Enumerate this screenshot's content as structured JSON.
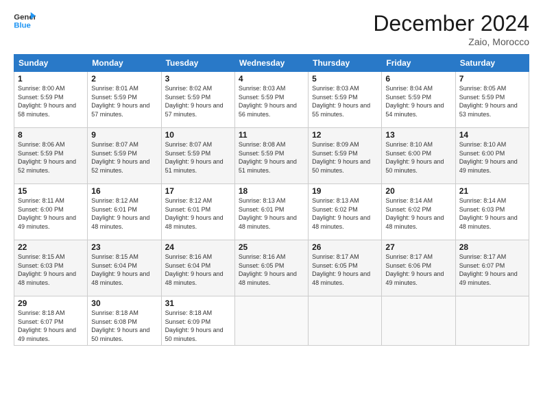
{
  "header": {
    "logo_line1": "General",
    "logo_line2": "Blue",
    "month": "December 2024",
    "location": "Zaio, Morocco"
  },
  "weekdays": [
    "Sunday",
    "Monday",
    "Tuesday",
    "Wednesday",
    "Thursday",
    "Friday",
    "Saturday"
  ],
  "weeks": [
    [
      {
        "day": "1",
        "sunrise": "8:00 AM",
        "sunset": "5:59 PM",
        "daylight": "9 hours and 58 minutes."
      },
      {
        "day": "2",
        "sunrise": "8:01 AM",
        "sunset": "5:59 PM",
        "daylight": "9 hours and 57 minutes."
      },
      {
        "day": "3",
        "sunrise": "8:02 AM",
        "sunset": "5:59 PM",
        "daylight": "9 hours and 57 minutes."
      },
      {
        "day": "4",
        "sunrise": "8:03 AM",
        "sunset": "5:59 PM",
        "daylight": "9 hours and 56 minutes."
      },
      {
        "day": "5",
        "sunrise": "8:03 AM",
        "sunset": "5:59 PM",
        "daylight": "9 hours and 55 minutes."
      },
      {
        "day": "6",
        "sunrise": "8:04 AM",
        "sunset": "5:59 PM",
        "daylight": "9 hours and 54 minutes."
      },
      {
        "day": "7",
        "sunrise": "8:05 AM",
        "sunset": "5:59 PM",
        "daylight": "9 hours and 53 minutes."
      }
    ],
    [
      {
        "day": "8",
        "sunrise": "8:06 AM",
        "sunset": "5:59 PM",
        "daylight": "9 hours and 52 minutes."
      },
      {
        "day": "9",
        "sunrise": "8:07 AM",
        "sunset": "5:59 PM",
        "daylight": "9 hours and 52 minutes."
      },
      {
        "day": "10",
        "sunrise": "8:07 AM",
        "sunset": "5:59 PM",
        "daylight": "9 hours and 51 minutes."
      },
      {
        "day": "11",
        "sunrise": "8:08 AM",
        "sunset": "5:59 PM",
        "daylight": "9 hours and 51 minutes."
      },
      {
        "day": "12",
        "sunrise": "8:09 AM",
        "sunset": "5:59 PM",
        "daylight": "9 hours and 50 minutes."
      },
      {
        "day": "13",
        "sunrise": "8:10 AM",
        "sunset": "6:00 PM",
        "daylight": "9 hours and 50 minutes."
      },
      {
        "day": "14",
        "sunrise": "8:10 AM",
        "sunset": "6:00 PM",
        "daylight": "9 hours and 49 minutes."
      }
    ],
    [
      {
        "day": "15",
        "sunrise": "8:11 AM",
        "sunset": "6:00 PM",
        "daylight": "9 hours and 49 minutes."
      },
      {
        "day": "16",
        "sunrise": "8:12 AM",
        "sunset": "6:01 PM",
        "daylight": "9 hours and 48 minutes."
      },
      {
        "day": "17",
        "sunrise": "8:12 AM",
        "sunset": "6:01 PM",
        "daylight": "9 hours and 48 minutes."
      },
      {
        "day": "18",
        "sunrise": "8:13 AM",
        "sunset": "6:01 PM",
        "daylight": "9 hours and 48 minutes."
      },
      {
        "day": "19",
        "sunrise": "8:13 AM",
        "sunset": "6:02 PM",
        "daylight": "9 hours and 48 minutes."
      },
      {
        "day": "20",
        "sunrise": "8:14 AM",
        "sunset": "6:02 PM",
        "daylight": "9 hours and 48 minutes."
      },
      {
        "day": "21",
        "sunrise": "8:14 AM",
        "sunset": "6:03 PM",
        "daylight": "9 hours and 48 minutes."
      }
    ],
    [
      {
        "day": "22",
        "sunrise": "8:15 AM",
        "sunset": "6:03 PM",
        "daylight": "9 hours and 48 minutes."
      },
      {
        "day": "23",
        "sunrise": "8:15 AM",
        "sunset": "6:04 PM",
        "daylight": "9 hours and 48 minutes."
      },
      {
        "day": "24",
        "sunrise": "8:16 AM",
        "sunset": "6:04 PM",
        "daylight": "9 hours and 48 minutes."
      },
      {
        "day": "25",
        "sunrise": "8:16 AM",
        "sunset": "6:05 PM",
        "daylight": "9 hours and 48 minutes."
      },
      {
        "day": "26",
        "sunrise": "8:17 AM",
        "sunset": "6:05 PM",
        "daylight": "9 hours and 48 minutes."
      },
      {
        "day": "27",
        "sunrise": "8:17 AM",
        "sunset": "6:06 PM",
        "daylight": "9 hours and 49 minutes."
      },
      {
        "day": "28",
        "sunrise": "8:17 AM",
        "sunset": "6:07 PM",
        "daylight": "9 hours and 49 minutes."
      }
    ],
    [
      {
        "day": "29",
        "sunrise": "8:18 AM",
        "sunset": "6:07 PM",
        "daylight": "9 hours and 49 minutes."
      },
      {
        "day": "30",
        "sunrise": "8:18 AM",
        "sunset": "6:08 PM",
        "daylight": "9 hours and 50 minutes."
      },
      {
        "day": "31",
        "sunrise": "8:18 AM",
        "sunset": "6:09 PM",
        "daylight": "9 hours and 50 minutes."
      },
      null,
      null,
      null,
      null
    ]
  ]
}
